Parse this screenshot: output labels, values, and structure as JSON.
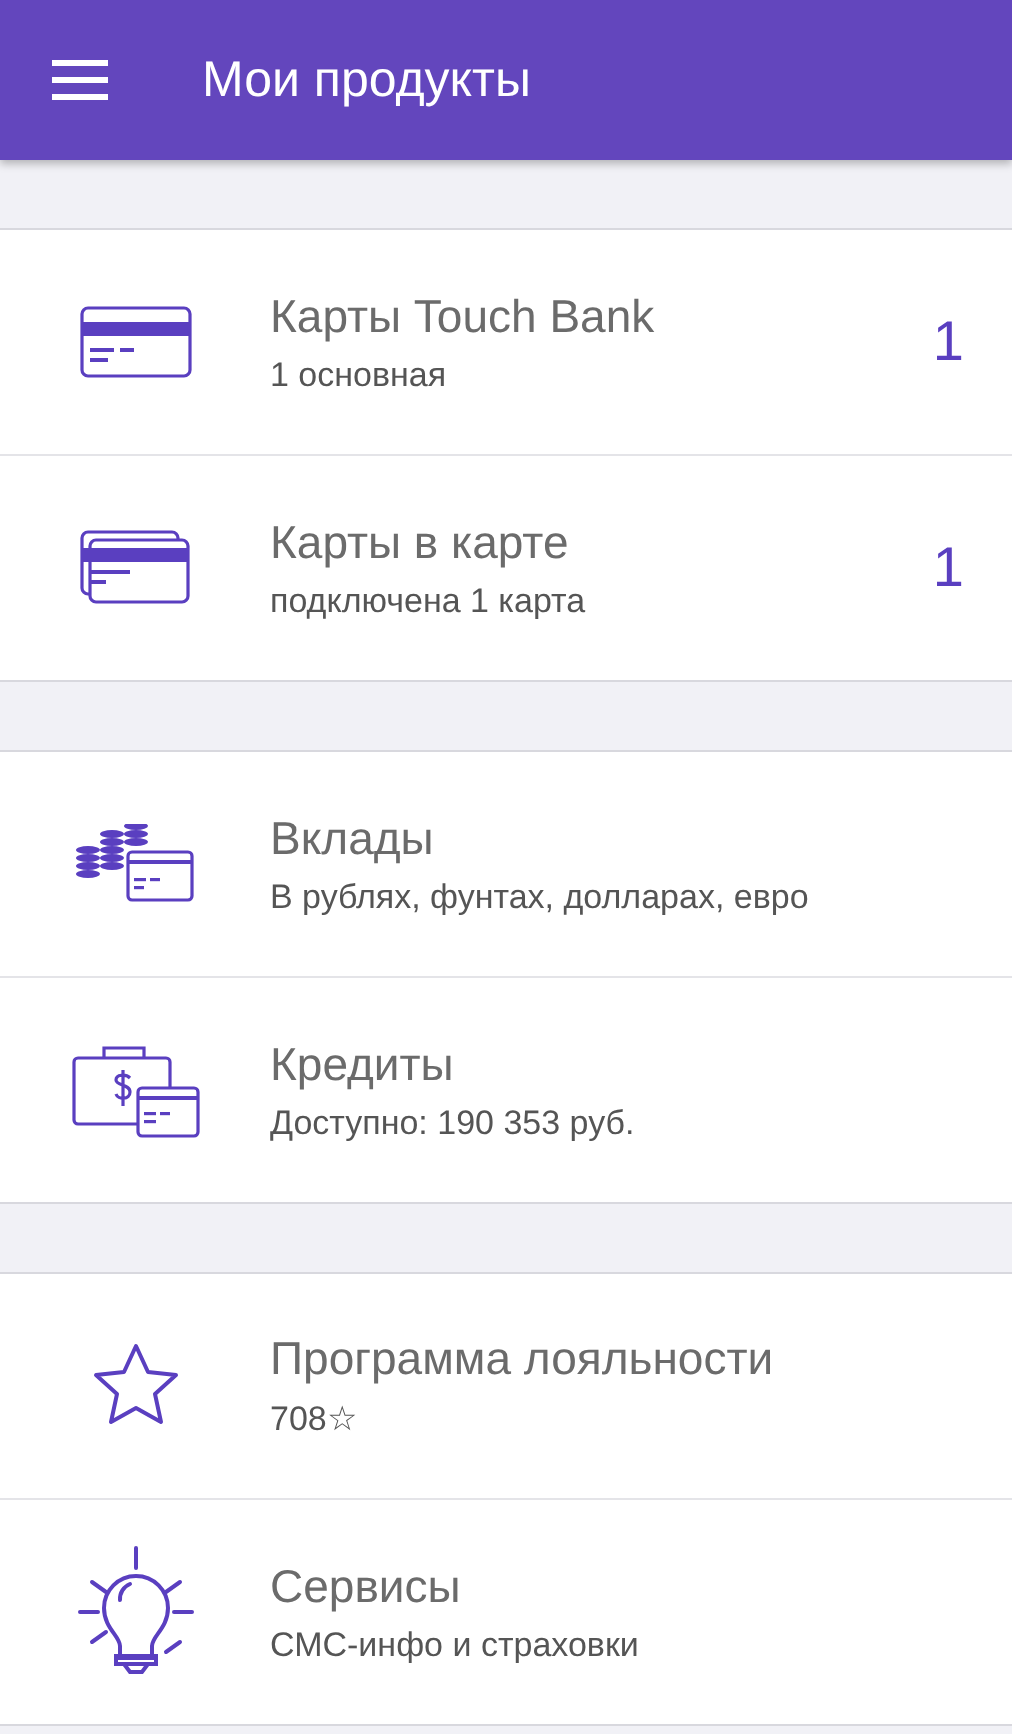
{
  "app_bar": {
    "title": "Мои продукты"
  },
  "sections": [
    {
      "items": [
        {
          "kind": "card",
          "title": "Карты Touch Bank",
          "subtitle": "1 основная",
          "count": "1"
        },
        {
          "kind": "cards",
          "title": "Карты в карте",
          "subtitle": "подключена 1 карта",
          "count": "1"
        }
      ]
    },
    {
      "items": [
        {
          "kind": "coins",
          "title": "Вклады",
          "subtitle": "В рублях, фунтах, долларах, евро"
        },
        {
          "kind": "briefcase",
          "title": "Кредиты",
          "subtitle": "Доступно: 190 353 руб."
        }
      ]
    },
    {
      "items": [
        {
          "kind": "star",
          "title": "Программа лояльности",
          "subtitle": "708☆"
        },
        {
          "kind": "bulb",
          "title": "Сервисы",
          "subtitle": "СМС-инфо и страховки"
        }
      ]
    }
  ]
}
